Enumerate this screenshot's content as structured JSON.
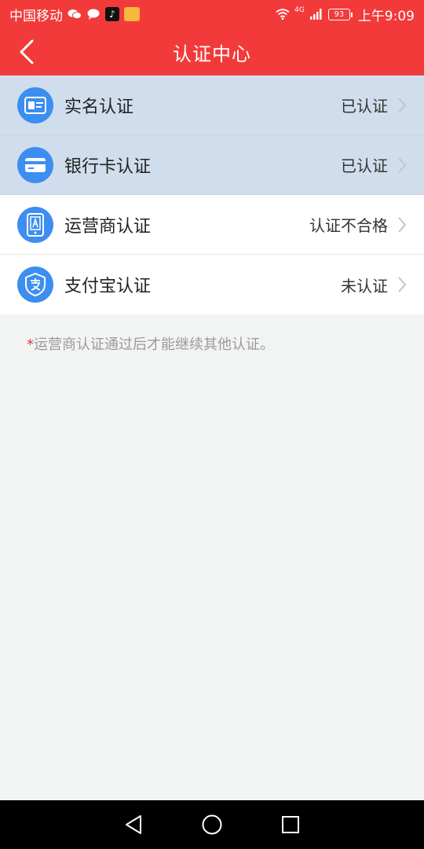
{
  "status_bar": {
    "carrier": "中国移动",
    "network": "4G",
    "battery": "93",
    "time": "上午9:09"
  },
  "header": {
    "title": "认证中心"
  },
  "items": [
    {
      "label": "实名认证",
      "status": "已认证",
      "icon": "id-card-icon"
    },
    {
      "label": "银行卡认证",
      "status": "已认证",
      "icon": "bank-card-icon"
    },
    {
      "label": "运营商认证",
      "status": "认证不合格",
      "icon": "phone-carrier-icon"
    },
    {
      "label": "支付宝认证",
      "status": "未认证",
      "icon": "alipay-icon"
    }
  ],
  "note": {
    "star": "*",
    "text": "运营商认证通过后才能继续其他认证。"
  },
  "colors": {
    "primary": "#f23a3a",
    "icon_blue": "#3c8ef0",
    "highlight": "#d0ddec",
    "background": "#f2f3f3"
  }
}
